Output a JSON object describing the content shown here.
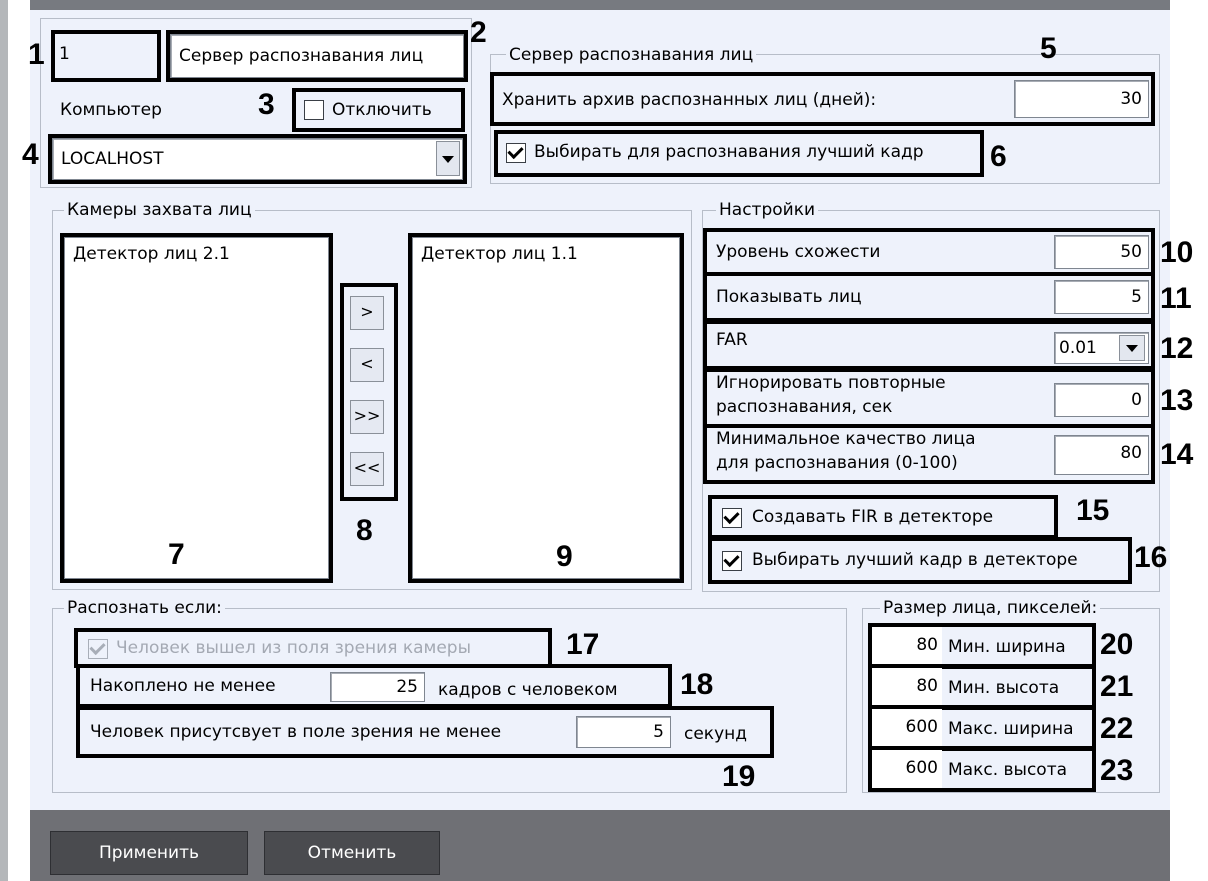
{
  "server": {
    "id_value": "1",
    "name_value": "Сервер распознавания лиц",
    "computer_label": "Компьютер",
    "disable_label": "Отключить",
    "disable_checked": false,
    "computer_value": "LOCALHOST"
  },
  "recognition_server": {
    "legend": "Сервер распознавания лиц",
    "keep_archive_label": "Хранить архив распознанных лиц (дней):",
    "keep_archive_value": "30",
    "best_frame_label": "Выбирать для распознавания лучший кадр",
    "best_frame_checked": true
  },
  "cameras": {
    "legend": "Камеры захвата лиц",
    "available": [
      "Детектор лиц 2.1"
    ],
    "selected": [
      "Детектор лиц 1.1"
    ],
    "btn_add": ">",
    "btn_remove": "<",
    "btn_add_all": ">>",
    "btn_remove_all": "<<"
  },
  "settings": {
    "legend": "Настройки",
    "similarity_label": "Уровень схожести",
    "similarity_value": "50",
    "show_faces_label": "Показывать лиц",
    "show_faces_value": "5",
    "far_label": "FAR",
    "far_value": "0.01",
    "ignore_label_1": "Игнорировать повторные",
    "ignore_label_2": "распознавания, сек",
    "ignore_value": "0",
    "min_quality_label_1": "Минимальное качество лица",
    "min_quality_label_2": "для распознавания (0-100)",
    "min_quality_value": "80",
    "create_fir_label": "Создавать FIR в детекторе",
    "create_fir_checked": true,
    "best_frame_detector_label": "Выбирать лучший кадр в детекторе",
    "best_frame_detector_checked": true
  },
  "recognize_if": {
    "legend": "Распознать если:",
    "left_view_label": "Человек вышел из поля зрения камеры",
    "left_view_checked": true,
    "accumulated_prefix": "Накоплено не менее",
    "accumulated_value": "25",
    "accumulated_suffix": "кадров с человеком",
    "present_prefix": "Человек присутсвует в поле зрения не менее",
    "present_value": "5",
    "present_suffix": "секунд"
  },
  "face_size": {
    "legend": "Размер лица, пикселей:",
    "min_width_value": "80",
    "min_width_label": "Мин. ширина",
    "min_height_value": "80",
    "min_height_label": "Мин. высота",
    "max_width_value": "600",
    "max_width_label": "Макс. ширина",
    "max_height_value": "600",
    "max_height_label": "Макс. высота"
  },
  "buttons": {
    "apply": "Применить",
    "cancel": "Отменить"
  },
  "callouts": [
    "1",
    "2",
    "3",
    "4",
    "5",
    "6",
    "7",
    "8",
    "9",
    "10",
    "11",
    "12",
    "13",
    "14",
    "15",
    "16",
    "17",
    "18",
    "19",
    "20",
    "21",
    "22",
    "23"
  ]
}
